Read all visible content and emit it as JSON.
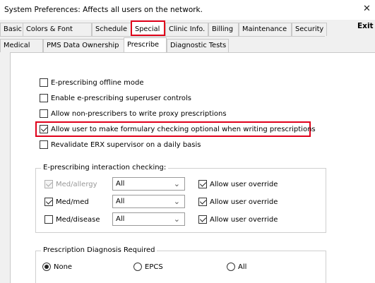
{
  "window": {
    "title": "System Preferences: Affects all users on the network.",
    "close_glyph": "✕",
    "exit_label": "Exit"
  },
  "main_tabs": [
    {
      "label": "Basic"
    },
    {
      "label": "Colors & Font"
    },
    {
      "label": "Schedule"
    },
    {
      "label": "Special",
      "active": true,
      "highlighted": true
    },
    {
      "label": "Clinic Info."
    },
    {
      "label": "Billing"
    },
    {
      "label": "Maintenance"
    },
    {
      "label": "Security"
    }
  ],
  "sub_tabs": [
    {
      "label": "Medical"
    },
    {
      "label": "PMS Data Ownership"
    },
    {
      "label": "Prescribe",
      "active": true,
      "highlighted": true
    },
    {
      "label": "Diagnostic Tests"
    }
  ],
  "options": [
    {
      "label": "E-prescribing offline mode",
      "checked": false
    },
    {
      "label": "Enable e-prescribing superuser controls",
      "checked": false
    },
    {
      "label": "Allow non-prescribers to write proxy prescriptions",
      "checked": false
    },
    {
      "label": "Allow user to make formulary checking optional when writing prescriptions",
      "checked": true,
      "highlighted": true
    },
    {
      "label": "Revalidate ERX supervisor on a daily basis",
      "checked": false
    }
  ],
  "interaction": {
    "title": "E-prescribing interaction checking:",
    "rows": [
      {
        "label": "Med/allergy",
        "checked": true,
        "disabled": true,
        "select_value": "All",
        "override_label": "Allow user override",
        "override_checked": true
      },
      {
        "label": "Med/med",
        "checked": true,
        "disabled": false,
        "select_value": "All",
        "override_label": "Allow user override",
        "override_checked": true
      },
      {
        "label": "Med/disease",
        "checked": false,
        "disabled": false,
        "select_value": "All",
        "override_label": "Allow user override",
        "override_checked": true
      }
    ]
  },
  "diagnosis": {
    "title": "Prescription Diagnosis Required",
    "options": [
      {
        "label": "None",
        "selected": true
      },
      {
        "label": "EPCS",
        "selected": false
      },
      {
        "label": "All",
        "selected": false
      }
    ]
  },
  "colors": {
    "highlight": "#e0001a",
    "panel_background": "#ffffff",
    "window_background": "#f0f0f0"
  },
  "icons": {
    "close": "close-icon",
    "dropdown": "chevron-down-icon"
  }
}
